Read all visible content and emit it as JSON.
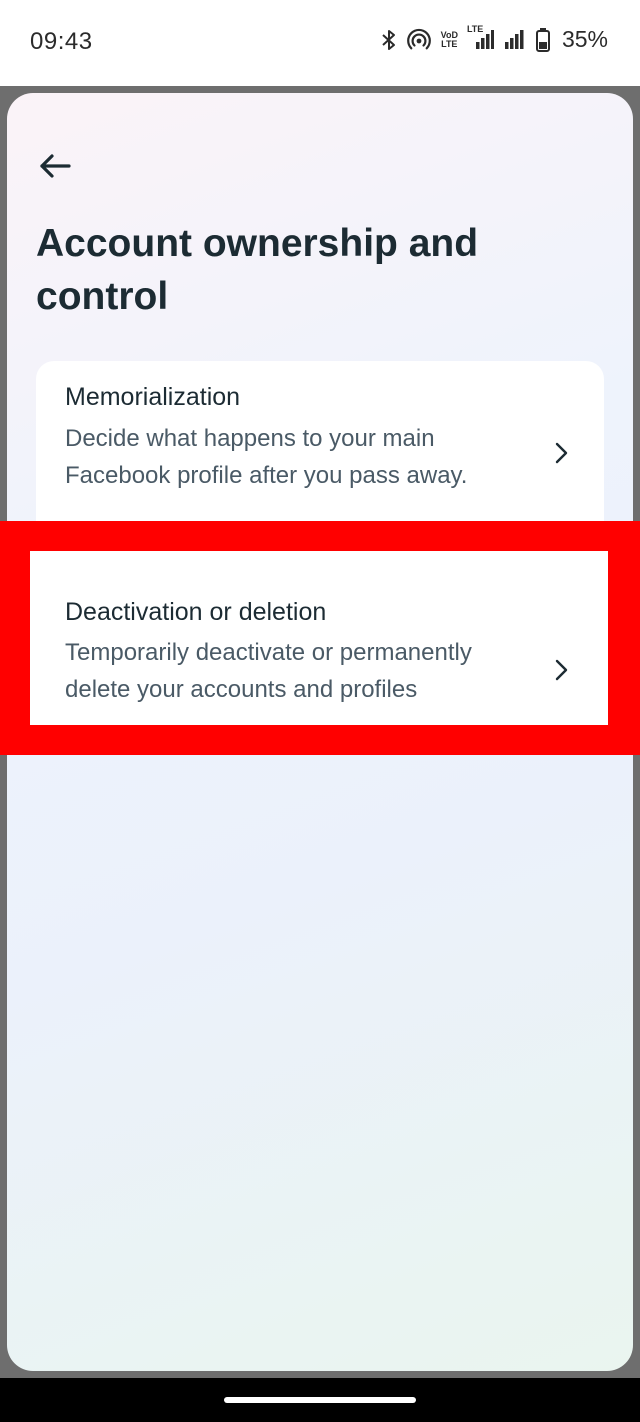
{
  "status_bar": {
    "time": "09:43",
    "battery": "35%",
    "lte_label": "LTE",
    "volte_label_top": "VoD",
    "volte_label_bottom": "LTE"
  },
  "header": {
    "back_icon": "arrow-left-icon",
    "title": "Account ownership and control"
  },
  "items": [
    {
      "title": "Memorialization",
      "description": "Decide what happens to your main Facebook profile after you pass away.",
      "icon": "chevron-right-icon"
    },
    {
      "title": "Deactivation or deletion",
      "description": "Temporarily deactivate or permanently delete your accounts and profiles",
      "icon": "chevron-right-icon"
    }
  ],
  "colors": {
    "highlight": "#ff0000",
    "title_text": "#1c2b33",
    "secondary_text": "#4a5a66"
  }
}
